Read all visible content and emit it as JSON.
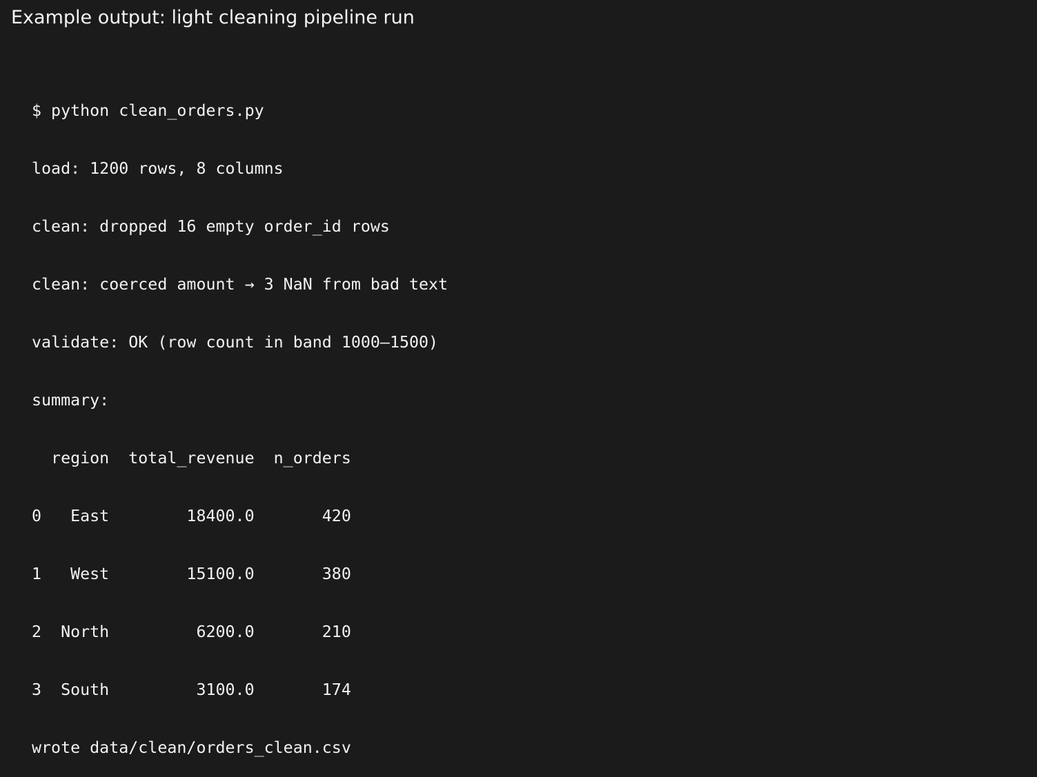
{
  "title": "Example output: light cleaning pipeline run",
  "terminal": {
    "lines": [
      "$ python clean_orders.py",
      "load: 1200 rows, 8 columns",
      "clean: dropped 16 empty order_id rows",
      "clean: coerced amount → 3 NaN from bad text",
      "validate: OK (row count in band 1000–1500)",
      "summary:",
      "  region  total_revenue  n_orders",
      "0   East        18400.0       420",
      "1   West        15100.0       380",
      "2  North         6200.0       210",
      "3  South         3100.0       174",
      "wrote data/clean/orders_clean.csv"
    ]
  }
}
